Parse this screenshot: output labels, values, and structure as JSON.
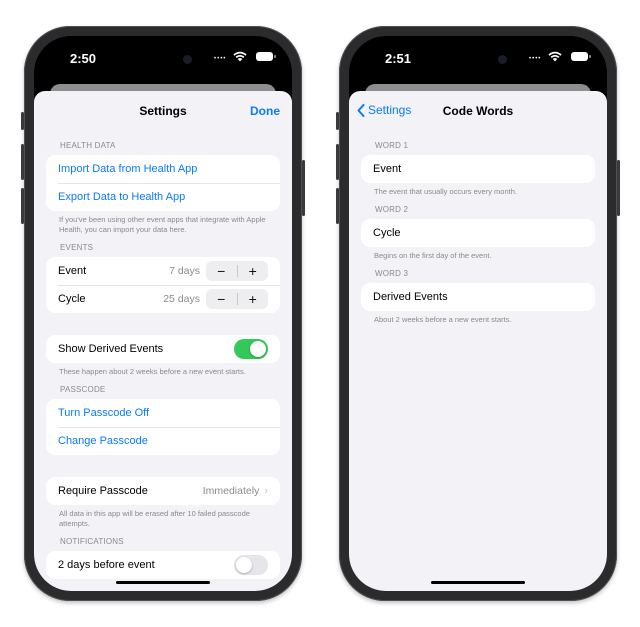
{
  "left": {
    "time": "2:50",
    "nav": {
      "title": "Settings",
      "done": "Done"
    },
    "health": {
      "header": "HEALTH DATA",
      "import": "Import Data from Health App",
      "export": "Export Data to Health App",
      "footer": "If you've been using other event apps that integrate with Apple Health, you can import your data here."
    },
    "events": {
      "header": "EVENTS",
      "rows": [
        {
          "label": "Event",
          "value": "7 days",
          "minus": "−",
          "plus": "+"
        },
        {
          "label": "Cycle",
          "value": "25 days",
          "minus": "−",
          "plus": "+"
        }
      ]
    },
    "derived": {
      "label": "Show Derived Events",
      "on": true,
      "footer": "These happen about 2 weeks before a new event starts."
    },
    "passcode": {
      "header": "PASSCODE",
      "off": "Turn Passcode Off",
      "change": "Change Passcode"
    },
    "require": {
      "label": "Require Passcode",
      "value": "Immediately",
      "footer": "All data in this app will be erased after 10 failed passcode attempts."
    },
    "notifications": {
      "header": "NOTIFICATIONS",
      "row": "2 days before event"
    }
  },
  "right": {
    "time": "2:51",
    "nav": {
      "back": "Settings",
      "title": "Code Words"
    },
    "words": [
      {
        "header": "WORD 1",
        "value": "Event",
        "footer": "The event that usually occurs every month."
      },
      {
        "header": "WORD 2",
        "value": "Cycle",
        "footer": "Begins on the first day of the event."
      },
      {
        "header": "WORD 3",
        "value": "Derived Events",
        "footer": "About 2 weeks before a new event starts."
      }
    ]
  },
  "colors": {
    "accent": "#0a7aff",
    "toggle_on": "#34c759",
    "background": "#f2f2f7"
  }
}
